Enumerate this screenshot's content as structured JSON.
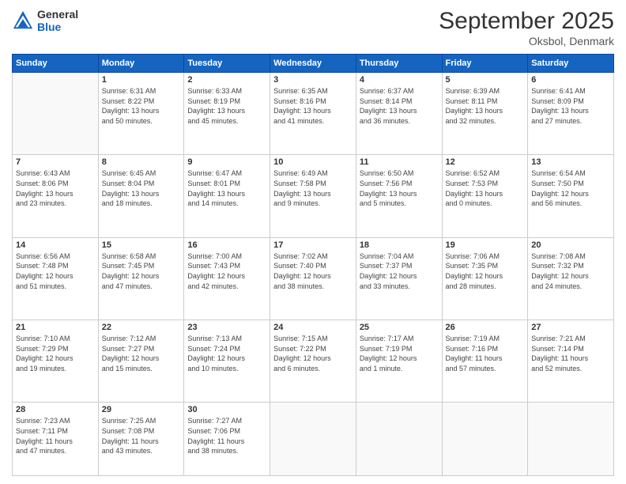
{
  "header": {
    "logo_general": "General",
    "logo_blue": "Blue",
    "month": "September 2025",
    "location": "Oksbol, Denmark"
  },
  "weekdays": [
    "Sunday",
    "Monday",
    "Tuesday",
    "Wednesday",
    "Thursday",
    "Friday",
    "Saturday"
  ],
  "weeks": [
    [
      {
        "day": "",
        "info": ""
      },
      {
        "day": "1",
        "info": "Sunrise: 6:31 AM\nSunset: 8:22 PM\nDaylight: 13 hours\nand 50 minutes."
      },
      {
        "day": "2",
        "info": "Sunrise: 6:33 AM\nSunset: 8:19 PM\nDaylight: 13 hours\nand 45 minutes."
      },
      {
        "day": "3",
        "info": "Sunrise: 6:35 AM\nSunset: 8:16 PM\nDaylight: 13 hours\nand 41 minutes."
      },
      {
        "day": "4",
        "info": "Sunrise: 6:37 AM\nSunset: 8:14 PM\nDaylight: 13 hours\nand 36 minutes."
      },
      {
        "day": "5",
        "info": "Sunrise: 6:39 AM\nSunset: 8:11 PM\nDaylight: 13 hours\nand 32 minutes."
      },
      {
        "day": "6",
        "info": "Sunrise: 6:41 AM\nSunset: 8:09 PM\nDaylight: 13 hours\nand 27 minutes."
      }
    ],
    [
      {
        "day": "7",
        "info": "Sunrise: 6:43 AM\nSunset: 8:06 PM\nDaylight: 13 hours\nand 23 minutes."
      },
      {
        "day": "8",
        "info": "Sunrise: 6:45 AM\nSunset: 8:04 PM\nDaylight: 13 hours\nand 18 minutes."
      },
      {
        "day": "9",
        "info": "Sunrise: 6:47 AM\nSunset: 8:01 PM\nDaylight: 13 hours\nand 14 minutes."
      },
      {
        "day": "10",
        "info": "Sunrise: 6:49 AM\nSunset: 7:58 PM\nDaylight: 13 hours\nand 9 minutes."
      },
      {
        "day": "11",
        "info": "Sunrise: 6:50 AM\nSunset: 7:56 PM\nDaylight: 13 hours\nand 5 minutes."
      },
      {
        "day": "12",
        "info": "Sunrise: 6:52 AM\nSunset: 7:53 PM\nDaylight: 13 hours\nand 0 minutes."
      },
      {
        "day": "13",
        "info": "Sunrise: 6:54 AM\nSunset: 7:50 PM\nDaylight: 12 hours\nand 56 minutes."
      }
    ],
    [
      {
        "day": "14",
        "info": "Sunrise: 6:56 AM\nSunset: 7:48 PM\nDaylight: 12 hours\nand 51 minutes."
      },
      {
        "day": "15",
        "info": "Sunrise: 6:58 AM\nSunset: 7:45 PM\nDaylight: 12 hours\nand 47 minutes."
      },
      {
        "day": "16",
        "info": "Sunrise: 7:00 AM\nSunset: 7:43 PM\nDaylight: 12 hours\nand 42 minutes."
      },
      {
        "day": "17",
        "info": "Sunrise: 7:02 AM\nSunset: 7:40 PM\nDaylight: 12 hours\nand 38 minutes."
      },
      {
        "day": "18",
        "info": "Sunrise: 7:04 AM\nSunset: 7:37 PM\nDaylight: 12 hours\nand 33 minutes."
      },
      {
        "day": "19",
        "info": "Sunrise: 7:06 AM\nSunset: 7:35 PM\nDaylight: 12 hours\nand 28 minutes."
      },
      {
        "day": "20",
        "info": "Sunrise: 7:08 AM\nSunset: 7:32 PM\nDaylight: 12 hours\nand 24 minutes."
      }
    ],
    [
      {
        "day": "21",
        "info": "Sunrise: 7:10 AM\nSunset: 7:29 PM\nDaylight: 12 hours\nand 19 minutes."
      },
      {
        "day": "22",
        "info": "Sunrise: 7:12 AM\nSunset: 7:27 PM\nDaylight: 12 hours\nand 15 minutes."
      },
      {
        "day": "23",
        "info": "Sunrise: 7:13 AM\nSunset: 7:24 PM\nDaylight: 12 hours\nand 10 minutes."
      },
      {
        "day": "24",
        "info": "Sunrise: 7:15 AM\nSunset: 7:22 PM\nDaylight: 12 hours\nand 6 minutes."
      },
      {
        "day": "25",
        "info": "Sunrise: 7:17 AM\nSunset: 7:19 PM\nDaylight: 12 hours\nand 1 minute."
      },
      {
        "day": "26",
        "info": "Sunrise: 7:19 AM\nSunset: 7:16 PM\nDaylight: 11 hours\nand 57 minutes."
      },
      {
        "day": "27",
        "info": "Sunrise: 7:21 AM\nSunset: 7:14 PM\nDaylight: 11 hours\nand 52 minutes."
      }
    ],
    [
      {
        "day": "28",
        "info": "Sunrise: 7:23 AM\nSunset: 7:11 PM\nDaylight: 11 hours\nand 47 minutes."
      },
      {
        "day": "29",
        "info": "Sunrise: 7:25 AM\nSunset: 7:08 PM\nDaylight: 11 hours\nand 43 minutes."
      },
      {
        "day": "30",
        "info": "Sunrise: 7:27 AM\nSunset: 7:06 PM\nDaylight: 11 hours\nand 38 minutes."
      },
      {
        "day": "",
        "info": ""
      },
      {
        "day": "",
        "info": ""
      },
      {
        "day": "",
        "info": ""
      },
      {
        "day": "",
        "info": ""
      }
    ]
  ]
}
